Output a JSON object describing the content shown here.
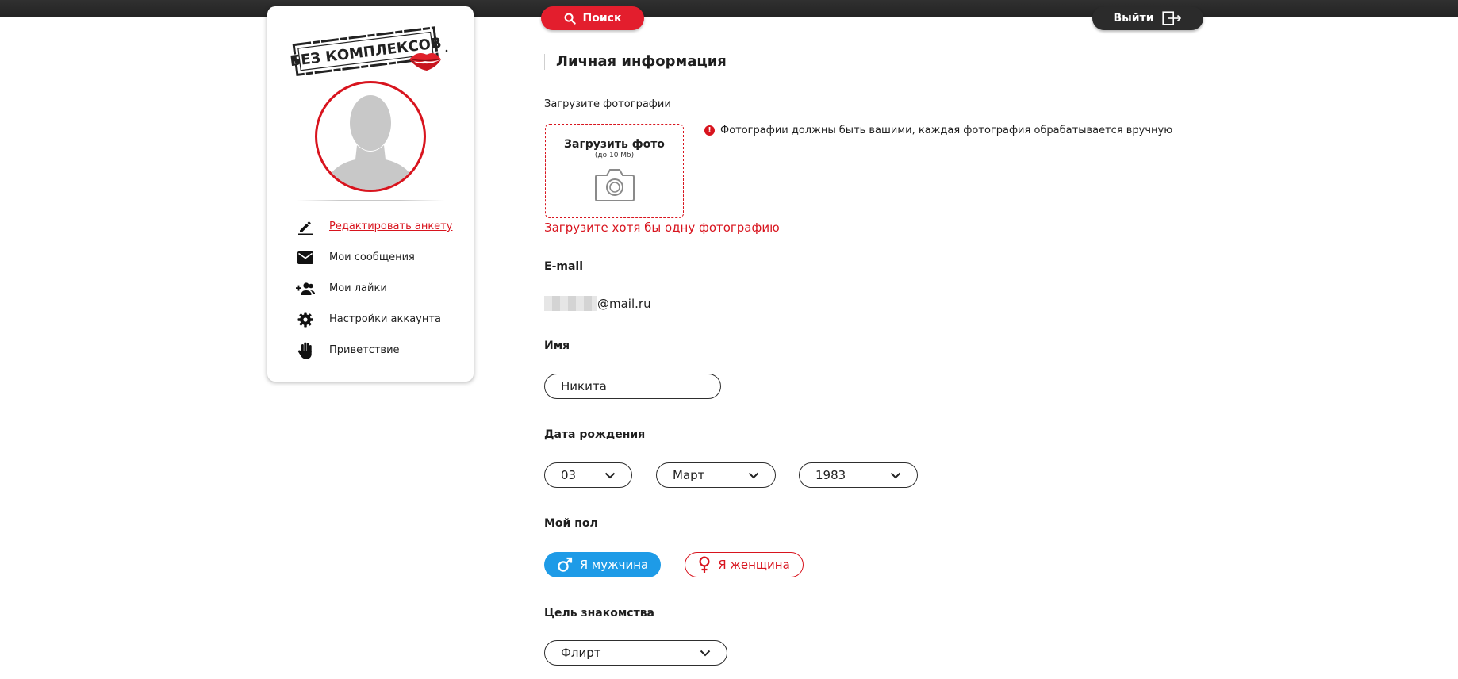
{
  "header": {
    "search_label": "Поиск",
    "logout_label": "Выйти"
  },
  "sidebar": {
    "logo_text": "БЕЗ КОМПЛЕКСОВ",
    "menu": [
      {
        "label": "Редактировать анкету",
        "icon": "pencil-icon",
        "active": true
      },
      {
        "label": "Мои сообщения",
        "icon": "envelope-icon",
        "active": false
      },
      {
        "label": "Мои лайки",
        "icon": "add-person-icon",
        "active": false
      },
      {
        "label": "Настройки аккаунта",
        "icon": "gear-icon",
        "active": false
      },
      {
        "label": "Приветствие",
        "icon": "hand-icon",
        "active": false
      }
    ]
  },
  "main": {
    "title": "Личная информация",
    "photos": {
      "label": "Загрузите фотографии",
      "upload_title": "Загрузить фото",
      "upload_sub": "(до 10 Мб)",
      "note": "Фотографии должны быть вашими, каждая фотография обрабатывается вручную",
      "note_icon": "!",
      "error": "Загрузите хотя бы одну фотографию"
    },
    "email": {
      "label": "E-mail",
      "value": "@mail.ru"
    },
    "name": {
      "label": "Имя",
      "value": "Никита"
    },
    "birth": {
      "label": "Дата рождения",
      "day": "03",
      "month": "Март",
      "year": "1983"
    },
    "gender": {
      "label": "Мой пол",
      "male": "Я мужчина",
      "female": "Я женщина",
      "selected": "male"
    },
    "goal": {
      "label": "Цель знакомства",
      "value": "Флирт"
    }
  },
  "colors": {
    "accent_red": "#d8141e",
    "male_blue": "#1e9be7",
    "topbar": "#2b2b2b"
  }
}
